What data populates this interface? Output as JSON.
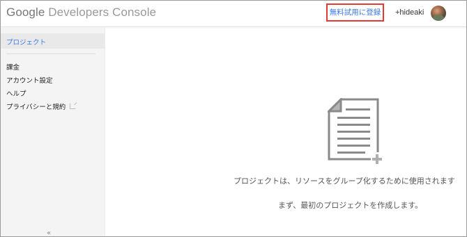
{
  "header": {
    "logo_google": "Google",
    "logo_product": "Developers Console",
    "trial_button_label": "無料試用に登録",
    "user_name": "+hideaki"
  },
  "sidebar": {
    "items": [
      {
        "label": "プロジェクト",
        "active": true
      },
      {
        "label": "課金"
      },
      {
        "label": "アカウント設定"
      },
      {
        "label": "ヘルプ"
      },
      {
        "label": "プライバシーと規約"
      }
    ],
    "collapse_label": "«"
  },
  "main": {
    "empty_state": {
      "icon": "document-add-icon",
      "line1": "プロジェクトは、リソースをグループ化するために使用されます",
      "line2": "まず、最初のプロジェクトを作成します。"
    }
  },
  "colors": {
    "accent": "#3b78e7",
    "highlight_border": "#e53935",
    "sidebar_bg": "#f4f4f4",
    "icon_gray": "#8a8a8a"
  }
}
